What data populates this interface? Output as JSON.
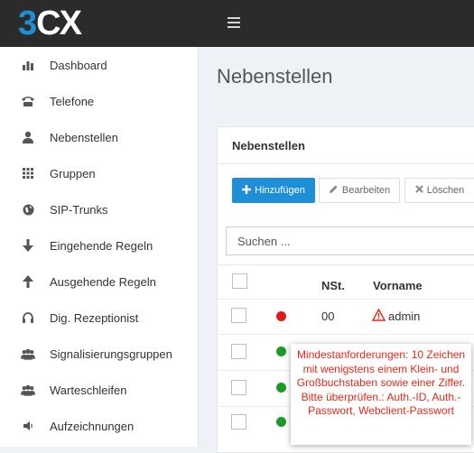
{
  "brand": {
    "logo_part1": "3",
    "logo_part2": "CX"
  },
  "sidebar": {
    "items": [
      {
        "label": "Dashboard",
        "icon": "bar-chart-icon"
      },
      {
        "label": "Telefone",
        "icon": "phone-icon"
      },
      {
        "label": "Nebenstellen",
        "icon": "user-icon"
      },
      {
        "label": "Gruppen",
        "icon": "grid-icon"
      },
      {
        "label": "SIP-Trunks",
        "icon": "globe-icon"
      },
      {
        "label": "Eingehende Regeln",
        "icon": "arrow-down-icon"
      },
      {
        "label": "Ausgehende Regeln",
        "icon": "arrow-up-icon"
      },
      {
        "label": "Dig. Rezeptionist",
        "icon": "headset-icon"
      },
      {
        "label": "Signalisierungsgruppen",
        "icon": "users-icon"
      },
      {
        "label": "Warteschleifen",
        "icon": "users-icon"
      },
      {
        "label": "Aufzeichnungen",
        "icon": "volume-icon"
      }
    ]
  },
  "main": {
    "page_title": "Nebenstellen",
    "panel_title": "Nebenstellen",
    "toolbar": {
      "add_label": "Hinzufügen",
      "edit_label": "Bearbeiten",
      "delete_label": "Löschen"
    },
    "search": {
      "placeholder": "Suchen ..."
    },
    "table": {
      "headers": {
        "ext": "NSt.",
        "first_name": "Vorname"
      },
      "rows": [
        {
          "status": "red",
          "ext": "00",
          "first_name": "admin",
          "warning": true
        },
        {
          "status": "green",
          "ext": "",
          "first_name": ""
        },
        {
          "status": "green",
          "ext": "",
          "first_name": ""
        },
        {
          "status": "green",
          "ext": "",
          "first_name": ""
        }
      ]
    }
  },
  "tooltip": {
    "text": "Mindestanforderungen: 10 Zeichen mit wenigstens einem Klein- und Großbuchstaben sowie einer Ziffer. Bitte überprüfen.: Auth.-ID, Auth.-Passwort, Webclient-Passwort"
  },
  "colors": {
    "accent": "#1e8fd6",
    "topbar": "#2b2b2b",
    "status_red": "#e01b1b",
    "status_green": "#1a9b23",
    "warning": "#e3281b"
  }
}
